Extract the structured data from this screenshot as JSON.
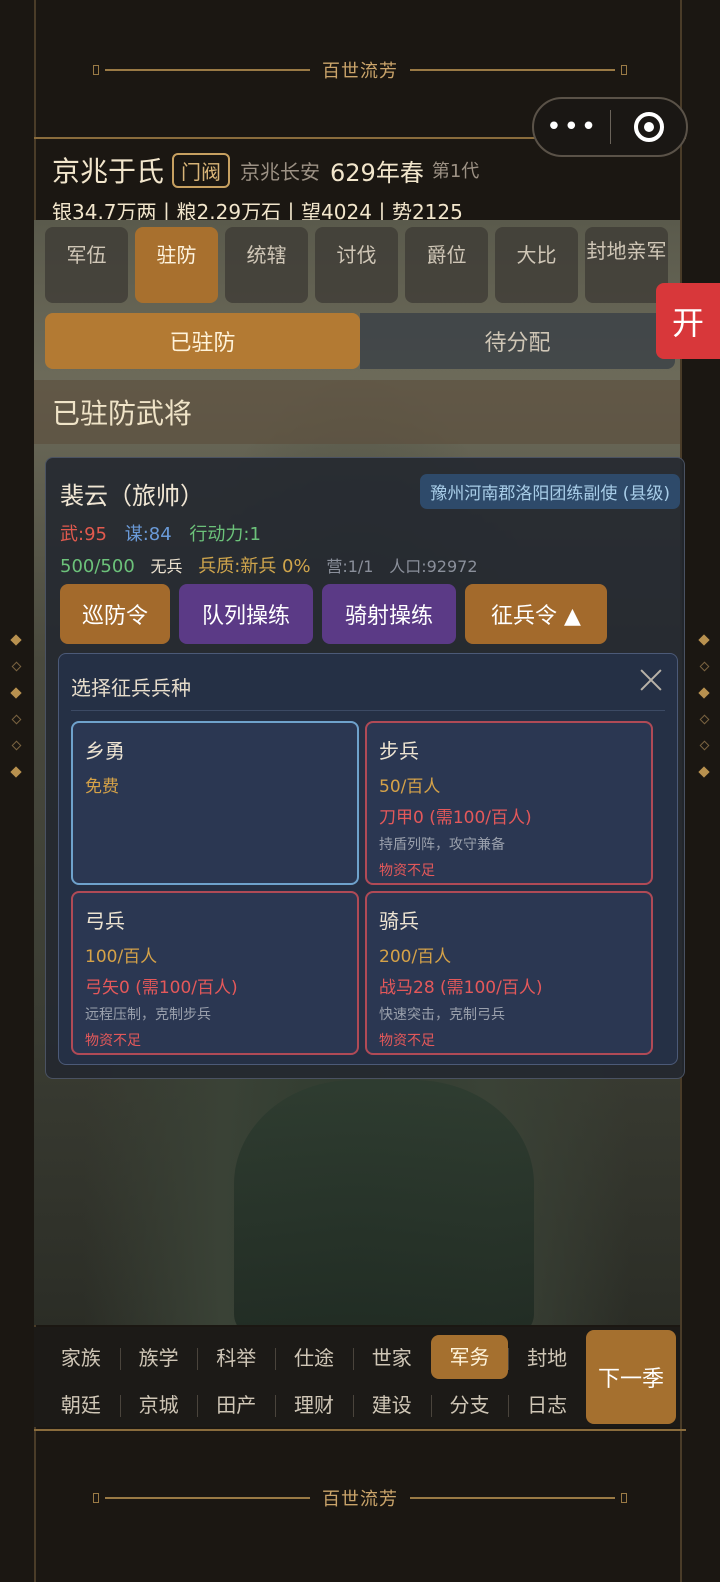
{
  "branding": {
    "banner": "百世流芳"
  },
  "header": {
    "clan_name": "京兆于氏",
    "clan_tag": "门阀",
    "location": "京兆长安",
    "season": "629年春",
    "generation": "第1代",
    "resources": "银34.7万两丨粮2.29万石丨望4024丨势2125"
  },
  "miniprogram": {
    "more": "•••",
    "close": "target"
  },
  "tabs": [
    {
      "label": "军伍"
    },
    {
      "label": "驻防"
    },
    {
      "label": "统辖"
    },
    {
      "label": "讨伐"
    },
    {
      "label": "爵位"
    },
    {
      "label": "大比"
    },
    {
      "label": "封地亲军"
    }
  ],
  "subtabs": [
    {
      "label": "已驻防"
    },
    {
      "label": "待分配"
    }
  ],
  "side_tab": "开",
  "section_title": "已驻防武将",
  "general": {
    "name": "裴云（旅帅）",
    "post": "豫州河南郡洛阳团练副使 (县级)",
    "wu": "武:95",
    "mou": "谋:84",
    "action": "行动力:1",
    "troops": "500/500",
    "arms": "无兵",
    "quality": "兵质:新兵 0%",
    "camp": "营:1/1",
    "population": "人口:92972",
    "actions": [
      {
        "label": "巡防令"
      },
      {
        "label": "队列操练"
      },
      {
        "label": "骑射操练"
      },
      {
        "label": "征兵令 ▲"
      }
    ]
  },
  "recruit_panel": {
    "title": "选择征兵兵种",
    "options": [
      {
        "name": "乡勇",
        "cost": "免费"
      },
      {
        "name": "步兵",
        "cost": "50/百人",
        "need": "刀甲0 (需100/百人)",
        "desc": "持盾列阵，攻守兼备",
        "warn": "物资不足"
      },
      {
        "name": "弓兵",
        "cost": "100/百人",
        "need": "弓矢0 (需100/百人)",
        "desc": "远程压制，克制步兵",
        "warn": "物资不足"
      },
      {
        "name": "骑兵",
        "cost": "200/百人",
        "need": "战马28 (需100/百人)",
        "desc": "快速突击，克制弓兵",
        "warn": "物资不足"
      }
    ]
  },
  "bottom_nav": {
    "row1": [
      "家族",
      "族学",
      "科举",
      "仕途",
      "世家",
      "军务",
      "封地"
    ],
    "row2": [
      "朝廷",
      "京城",
      "田产",
      "理财",
      "建设",
      "分支",
      "日志"
    ],
    "next": "下一季"
  }
}
